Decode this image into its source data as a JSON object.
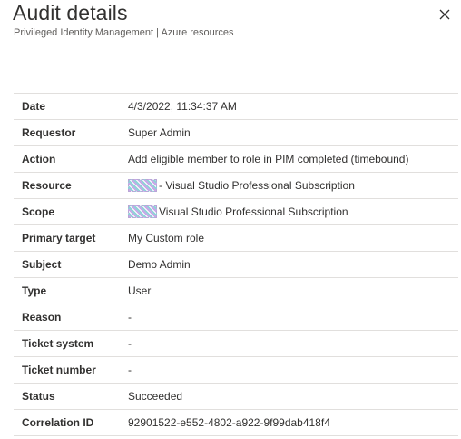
{
  "header": {
    "title": "Audit details",
    "subtitle": "Privileged Identity Management | Azure resources"
  },
  "details": [
    {
      "label": "Date",
      "value": "4/3/2022, 11:34:37 AM",
      "redacted": false
    },
    {
      "label": "Requestor",
      "value": "Super Admin",
      "redacted": false
    },
    {
      "label": "Action",
      "value": "Add eligible member to role in PIM completed (timebound)",
      "redacted": false
    },
    {
      "label": "Resource",
      "value": "- Visual Studio Professional Subscription",
      "redacted": true
    },
    {
      "label": "Scope",
      "value": "Visual Studio Professional Subscription",
      "redacted": true
    },
    {
      "label": "Primary target",
      "value": "My Custom role",
      "redacted": false
    },
    {
      "label": "Subject",
      "value": "Demo Admin",
      "redacted": false
    },
    {
      "label": "Type",
      "value": "User",
      "redacted": false
    },
    {
      "label": "Reason",
      "value": "-",
      "redacted": false
    },
    {
      "label": "Ticket system",
      "value": "-",
      "redacted": false
    },
    {
      "label": "Ticket number",
      "value": "-",
      "redacted": false
    },
    {
      "label": "Status",
      "value": "Succeeded",
      "redacted": false
    },
    {
      "label": "Correlation ID",
      "value": "92901522-e552-4802-a922-9f99dab418f4",
      "redacted": false
    }
  ],
  "icons": {
    "close": "close-icon",
    "redaction": "redacted-name-icon"
  }
}
